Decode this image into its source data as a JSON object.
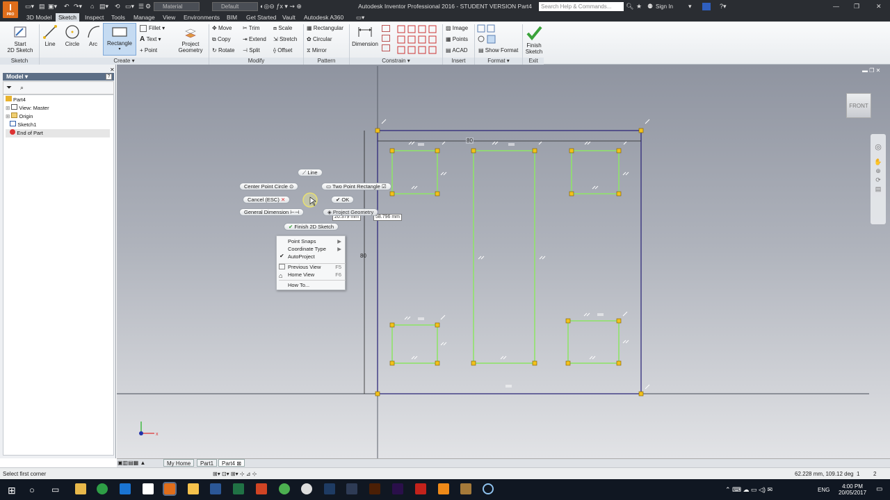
{
  "app": {
    "logo_letter": "I",
    "logo_sub": "PRO",
    "title": "Autodesk Inventor Professional 2016 - STUDENT VERSION   Part4",
    "material": "Material",
    "appearance": "Default",
    "search_placeholder": "Search Help & Commands...",
    "signin": "Sign In"
  },
  "tabs": [
    "3D Model",
    "Sketch",
    "Inspect",
    "Tools",
    "Manage",
    "View",
    "Environments",
    "BIM",
    "Get Started",
    "Vault",
    "Autodesk A360"
  ],
  "ribbon": {
    "sketch": {
      "start_l1": "Start",
      "start_l2": "2D Sketch",
      "group": "Sketch"
    },
    "create": {
      "line": "Line",
      "circle": "Circle",
      "arc": "Arc",
      "rectangle": "Rectangle",
      "fillet": "Fillet",
      "text": "Text",
      "point": "Point",
      "project_l1": "Project",
      "project_l2": "Geometry",
      "group": "Create"
    },
    "modify": {
      "move": "Move",
      "trim": "Trim",
      "scale": "Scale",
      "copy": "Copy",
      "extend": "Extend",
      "stretch": "Stretch",
      "rotate": "Rotate",
      "split": "Split",
      "offset": "Offset",
      "group": "Modify"
    },
    "pattern": {
      "rectangular": "Rectangular",
      "circular": "Circular",
      "mirror": "Mirror",
      "group": "Pattern"
    },
    "constrain": {
      "dimension": "Dimension",
      "group": "Constrain"
    },
    "insert": {
      "image": "Image",
      "points": "Points",
      "acad": "ACAD",
      "group": "Insert"
    },
    "format": {
      "show_format": "Show Format",
      "group": "Format"
    },
    "exit": {
      "finish_l1": "Finish",
      "finish_l2": "Sketch",
      "group": "Exit"
    }
  },
  "panel": {
    "title": "Model",
    "tree": [
      "Part4",
      "View: Master",
      "Origin",
      "Sketch1",
      "End of Part"
    ]
  },
  "marking_menu": {
    "line": "Line",
    "two_point_rect": "Two Point Rectangle",
    "center_point_circle": "Center Point Circle",
    "ok": "OK",
    "cancel": "Cancel (ESC)",
    "general_dimension": "General Dimension",
    "project_geometry": "Project Geometry",
    "finish_2d": "Finish 2D Sketch"
  },
  "context_menu": [
    {
      "label": "Point Snaps",
      "shortcut": "▶"
    },
    {
      "label": "Coordinate Type",
      "shortcut": "▶"
    },
    {
      "label": "AutoProject",
      "shortcut": ""
    },
    {
      "label": "Previous View",
      "shortcut": "F5"
    },
    {
      "label": "Home View",
      "shortcut": "F6"
    },
    {
      "label": "How To...",
      "shortcut": ""
    }
  ],
  "dimensions": {
    "top": "80",
    "left": "80",
    "input1": "20.379 mm",
    "input2": "58.796 mm"
  },
  "viewcube": "FRONT",
  "bottom_tabs": [
    "My Home",
    "Part1",
    "Part4"
  ],
  "status": {
    "prompt": "Select first corner",
    "coords": "62.228 mm, 109.12 deg",
    "n1": "1",
    "n2": "2"
  },
  "taskbar": {
    "lang": "ENG",
    "time": "4:00 PM",
    "date": "20/05/2017"
  },
  "colors": {
    "accent": "#e06e1b",
    "sketch_line": "#8fe36a",
    "frame": "#2f2a7a",
    "point": "#f2c11b"
  }
}
